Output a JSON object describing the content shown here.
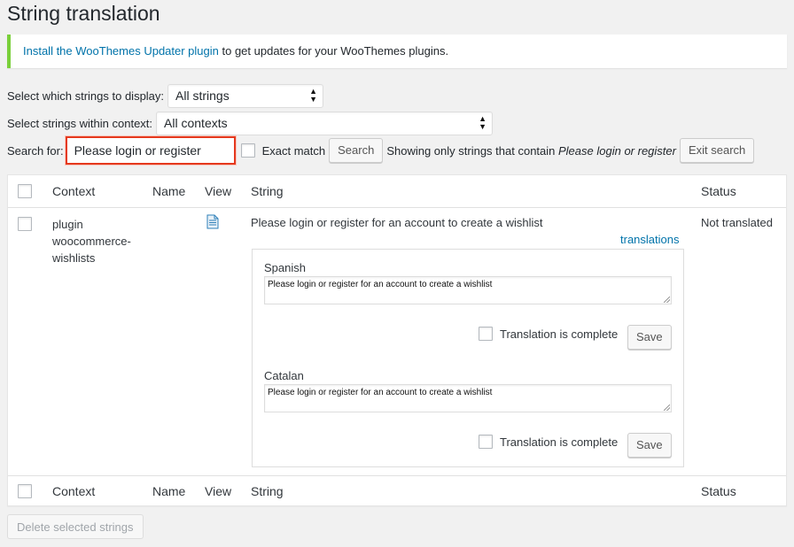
{
  "page": {
    "title": "String translation"
  },
  "notice": {
    "link_text": "Install the WooThemes Updater plugin",
    "text": " to get updates for your WooThemes plugins."
  },
  "filters": {
    "display_label": "Select which strings to display:",
    "display_value": "All strings",
    "context_label": "Select strings within context:",
    "context_value": "All contexts",
    "search_label": "Search for:",
    "search_value": "Please login or register",
    "exact_match_label": "Exact match",
    "search_button": "Search",
    "showing_prefix": "Showing only strings that contain ",
    "showing_term": "Please login or register",
    "exit_search_button": "Exit search"
  },
  "table": {
    "columns": [
      "Context",
      "Name",
      "View",
      "String",
      "Status"
    ],
    "row": {
      "context_lines": [
        "plugin",
        "woocommerce-",
        "wishlists"
      ],
      "name": "",
      "view_icon": "document-icon",
      "string": "Please login or register for an account to create a wishlist",
      "status": "Not translated",
      "translations_link": "translations",
      "translations": [
        {
          "language": "Spanish",
          "value": "Please login or register for an account to create a wishlist",
          "complete_label": "Translation is complete",
          "save_label": "Save"
        },
        {
          "language": "Catalan",
          "value": "Please login or register for an account to create a wishlist",
          "complete_label": "Translation is complete",
          "save_label": "Save"
        }
      ]
    }
  },
  "footer": {
    "delete_button": "Delete selected strings"
  },
  "colors": {
    "accent": "#0073aa",
    "notice_border": "#7ad03a",
    "highlight": "#e5391e"
  }
}
